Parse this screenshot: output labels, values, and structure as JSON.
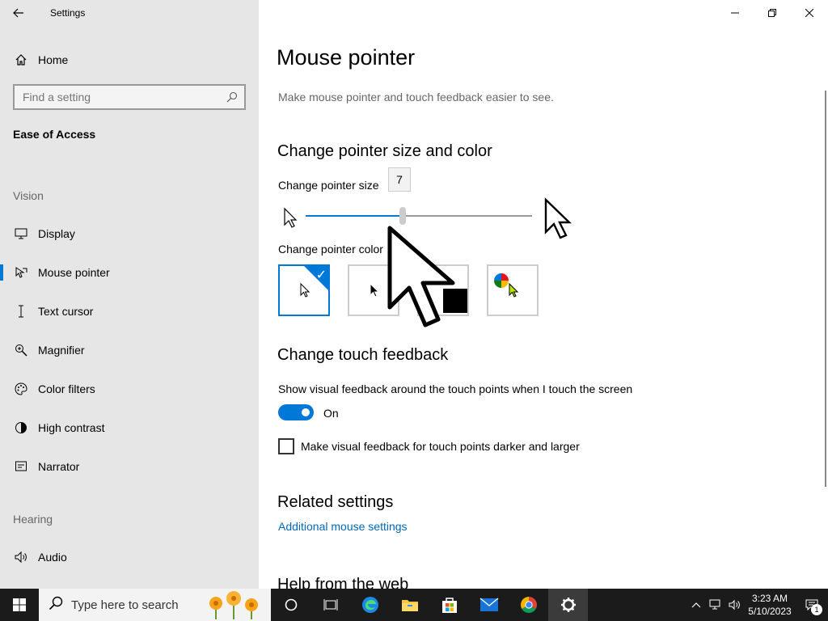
{
  "window": {
    "app_title": "Settings",
    "back_icon": "back-arrow-icon",
    "controls": [
      "minimize-icon",
      "restore-icon",
      "close-icon"
    ]
  },
  "sidebar": {
    "home_label": "Home",
    "search_placeholder": "Find a setting",
    "section": "Ease of Access",
    "groups": [
      {
        "label": "Vision"
      },
      {
        "label": "Hearing"
      }
    ],
    "items": [
      {
        "label": "Display",
        "icon": "monitor-icon"
      },
      {
        "label": "Mouse pointer",
        "icon": "mouse-pointer-icon",
        "selected": true
      },
      {
        "label": "Text cursor",
        "icon": "text-cursor-icon"
      },
      {
        "label": "Magnifier",
        "icon": "magnifier-icon"
      },
      {
        "label": "Color filters",
        "icon": "color-filters-icon"
      },
      {
        "label": "High contrast",
        "icon": "high-contrast-icon"
      },
      {
        "label": "Narrator",
        "icon": "narrator-icon"
      },
      {
        "label": "Audio",
        "icon": "audio-icon"
      }
    ]
  },
  "main": {
    "title": "Mouse pointer",
    "description": "Make mouse pointer and touch feedback easier to see.",
    "size_color_heading": "Change pointer size and color",
    "pointer_size_label": "Change pointer size",
    "pointer_size_value": "7",
    "pointer_size_min": 1,
    "pointer_size_max": 15,
    "pointer_color_label": "Change pointer color",
    "color_options": [
      "white",
      "black",
      "inverted",
      "custom"
    ],
    "selected_color": "white",
    "touch_heading": "Change touch feedback",
    "touch_desc": "Show visual feedback around the touch points when I touch the screen",
    "toggle_state": "On",
    "darker_label": "Make visual feedback for touch points darker and larger",
    "darker_checked": false,
    "related_heading": "Related settings",
    "related_link": "Additional mouse settings",
    "help_heading": "Help from the web"
  },
  "taskbar": {
    "search_placeholder": "Type here to search",
    "time": "3:23 AM",
    "date": "5/10/2023",
    "notification_count": "1",
    "apps": [
      "cortana-icon",
      "task-view-icon",
      "edge-icon",
      "file-explorer-icon",
      "store-icon",
      "mail-icon",
      "chrome-icon",
      "settings-gear-icon"
    ]
  },
  "colors": {
    "accent": "#0078d7",
    "link": "#0067b8",
    "sidebar_bg": "#e6e6e6",
    "taskbar_bg": "#1b1b1b"
  }
}
